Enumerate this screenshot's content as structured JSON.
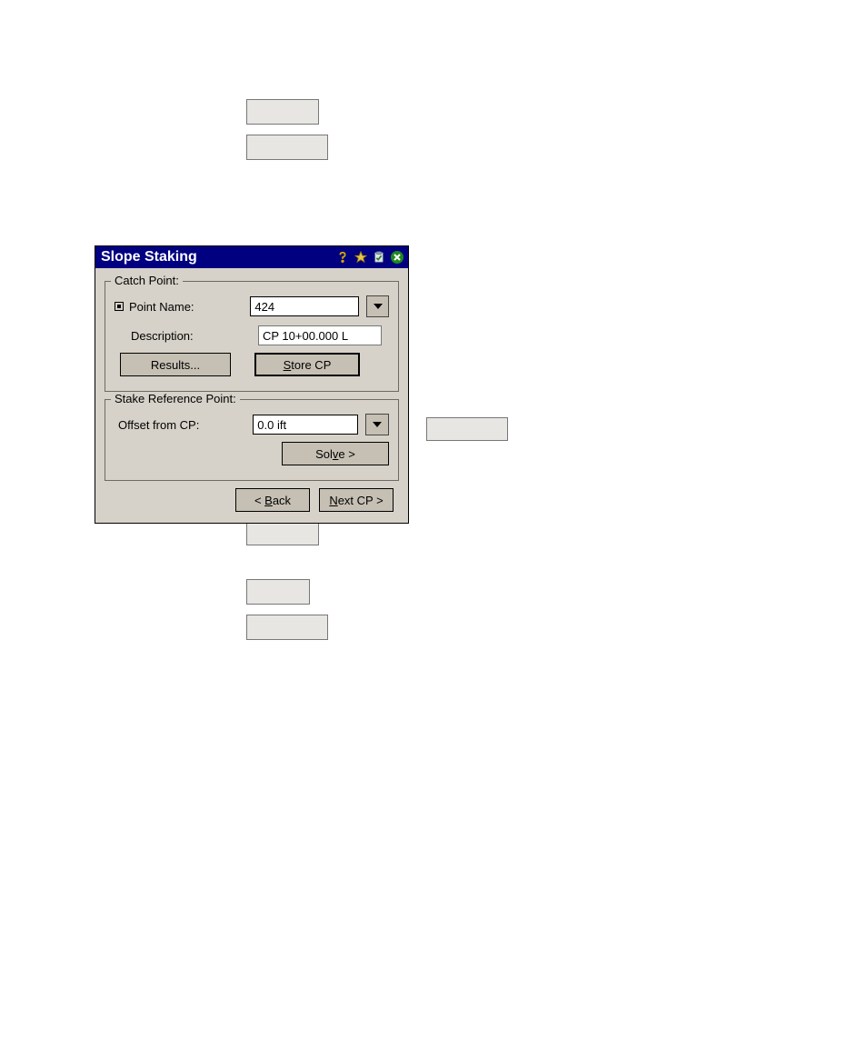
{
  "dialog": {
    "title": "Slope Staking",
    "catchpoint": {
      "legend": "Catch Point:",
      "pointname_label": "Point Name:",
      "pointname_value": "424",
      "description_label": "Description:",
      "description_value": "CP 10+00.000 L",
      "results_label": "Results...",
      "storecp_label_pre": "",
      "storecp_u": "S",
      "storecp_label_post": "tore CP"
    },
    "stakeref": {
      "legend": "Stake Reference Point:",
      "offset_label": "Offset from CP:",
      "offset_value": "0.0 ift",
      "solve_pre": "Sol",
      "solve_u": "v",
      "solve_post": "e >"
    },
    "footer": {
      "back_pre": "< ",
      "back_u": "B",
      "back_post": "ack",
      "next_pre": "",
      "next_u": "N",
      "next_post": "ext CP >"
    }
  }
}
